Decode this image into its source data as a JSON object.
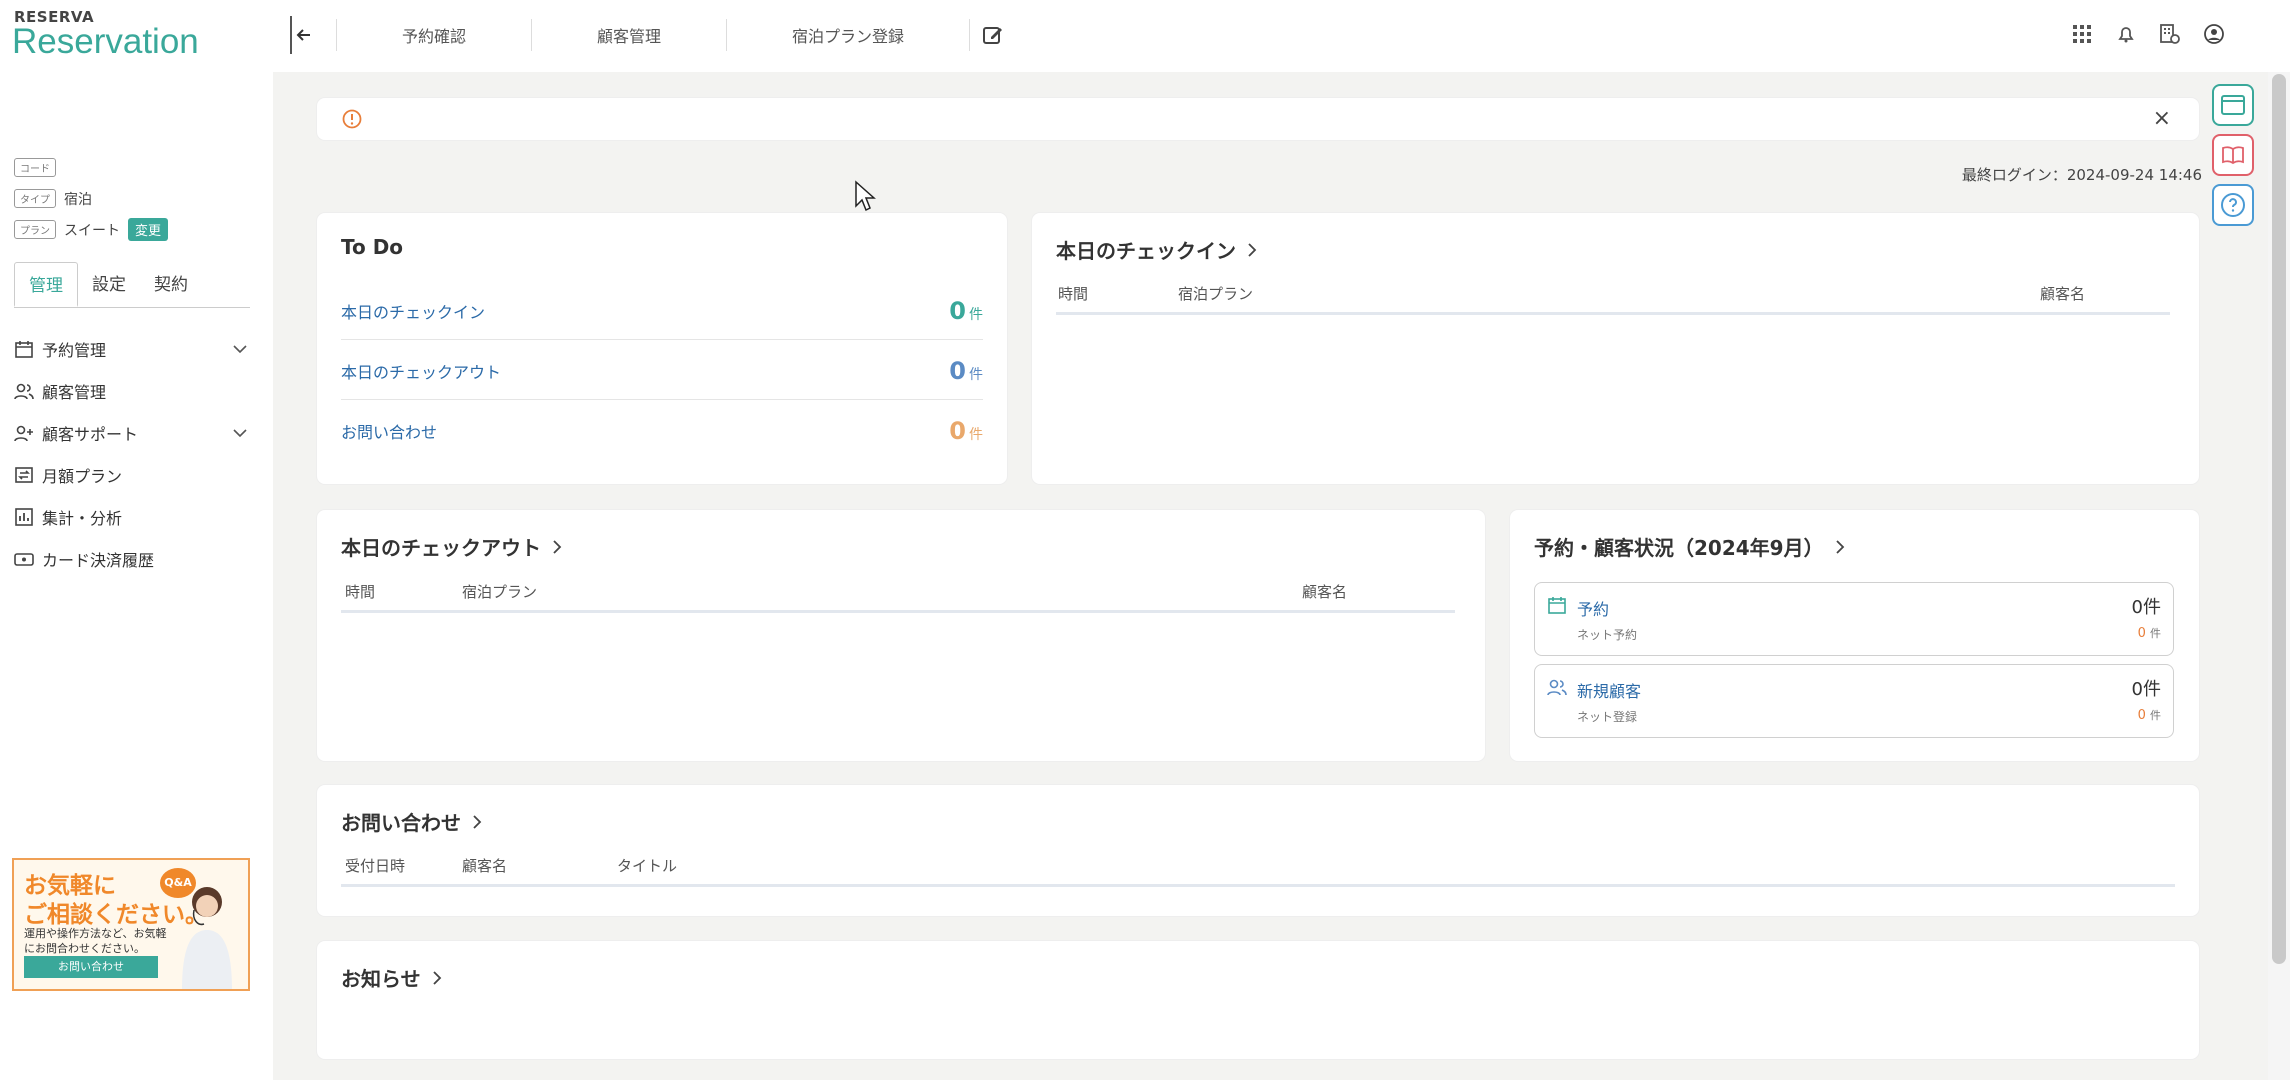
{
  "app": {
    "brand_small": "RESERVA",
    "brand": "Reservation"
  },
  "topnav": {
    "items": [
      "予約確認",
      "顧客管理",
      "宿泊プラン登録"
    ]
  },
  "sidebar": {
    "info": [
      {
        "tag": "コード",
        "value": ""
      },
      {
        "tag": "タイプ",
        "value": "宿泊"
      },
      {
        "tag": "プラン",
        "value": "スイート"
      }
    ],
    "change_label": "変更",
    "tabs": [
      "管理",
      "設定",
      "契約"
    ],
    "menu": [
      {
        "label": "予約管理",
        "icon": "calendar-icon"
      },
      {
        "label": "顧客管理",
        "icon": "users-icon"
      },
      {
        "label": "顧客サポート",
        "icon": "user-plus-icon"
      },
      {
        "label": "月額プラン",
        "icon": "repeat-icon"
      },
      {
        "label": "集計・分析",
        "icon": "bar-chart-icon"
      },
      {
        "label": "カード決済履歴",
        "icon": "card-icon"
      }
    ],
    "banner": {
      "line1": "お気軽に",
      "line2": "ご相談ください。",
      "line3": "運用や操作方法など、お気軽にお問合わせください。",
      "button": "お問い合わせ",
      "badge": "Q&A"
    }
  },
  "main": {
    "last_login": "最終ログイン：2024-09-24 14:46",
    "todo": {
      "title": "To Do",
      "unit": "件",
      "rows": [
        {
          "label": "本日のチェックイン",
          "count": "0",
          "color": "#3aa89a"
        },
        {
          "label": "本日のチェックアウト",
          "count": "0",
          "color": "#5b8bc4"
        },
        {
          "label": "お問い合わせ",
          "count": "0",
          "color": "#e9a86b"
        }
      ]
    },
    "checkin": {
      "title": "本日のチェックイン",
      "cols": [
        "時間",
        "宿泊プラン",
        "顧客名"
      ]
    },
    "checkout": {
      "title": "本日のチェックアウト",
      "cols": [
        "時間",
        "宿泊プラン",
        "顧客名"
      ]
    },
    "status": {
      "title": "予約・顧客状況（2024年9月）",
      "unit": "件",
      "cards": [
        {
          "label": "予約",
          "count": "0",
          "sub": "ネット予約",
          "subcount": "0"
        },
        {
          "label": "新規顧客",
          "count": "0",
          "sub": "ネット登録",
          "subcount": "0"
        }
      ]
    },
    "inquiry": {
      "title": "お問い合わせ",
      "cols": [
        "受付日時",
        "顧客名",
        "タイトル"
      ]
    },
    "news": {
      "title": "お知らせ"
    }
  },
  "colors": {
    "accent": "#3aa89a",
    "link": "#2b6aa8",
    "warn": "#e87e3a"
  }
}
